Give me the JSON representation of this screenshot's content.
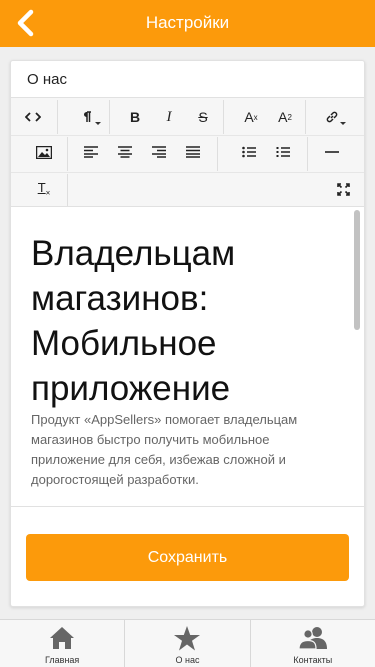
{
  "header": {
    "title": "Настройки",
    "back_icon": "chevron-left-icon",
    "bg_color": "#fc9a0b"
  },
  "section": {
    "label": "О нас"
  },
  "toolbar": {
    "row1": [
      "code-view-icon",
      "paragraph-icon",
      "bold-icon",
      "italic-icon",
      "strikethrough-icon",
      "superscript-icon",
      "subscript-icon",
      "link-icon"
    ],
    "row2": [
      "image-icon",
      "align-left-icon",
      "align-center-icon",
      "align-right-icon",
      "align-justify-icon",
      "bulleted-list-icon",
      "numbered-list-icon",
      "horizontal-rule-icon"
    ],
    "row3": [
      "clear-format-icon",
      "fullscreen-icon"
    ],
    "bold_label": "B",
    "italic_label": "I",
    "strike_label": "S",
    "super_label": "A",
    "sub_label": "A",
    "clear_label": "T"
  },
  "editor": {
    "heading": "Владельцам магазинов: Мобильное приложение",
    "paragraph": "Продукт «AppSellers» помогает владельцам магазинов быстро получить мобильное приложение для себя, избежав сложной и дорогостоящей разработки."
  },
  "actions": {
    "save_label": "Сохранить"
  },
  "tabbar": {
    "items": [
      {
        "label": "Главная",
        "icon": "home-icon"
      },
      {
        "label": "О нас",
        "icon": "star-icon"
      },
      {
        "label": "Контакты",
        "icon": "contacts-icon"
      }
    ]
  }
}
